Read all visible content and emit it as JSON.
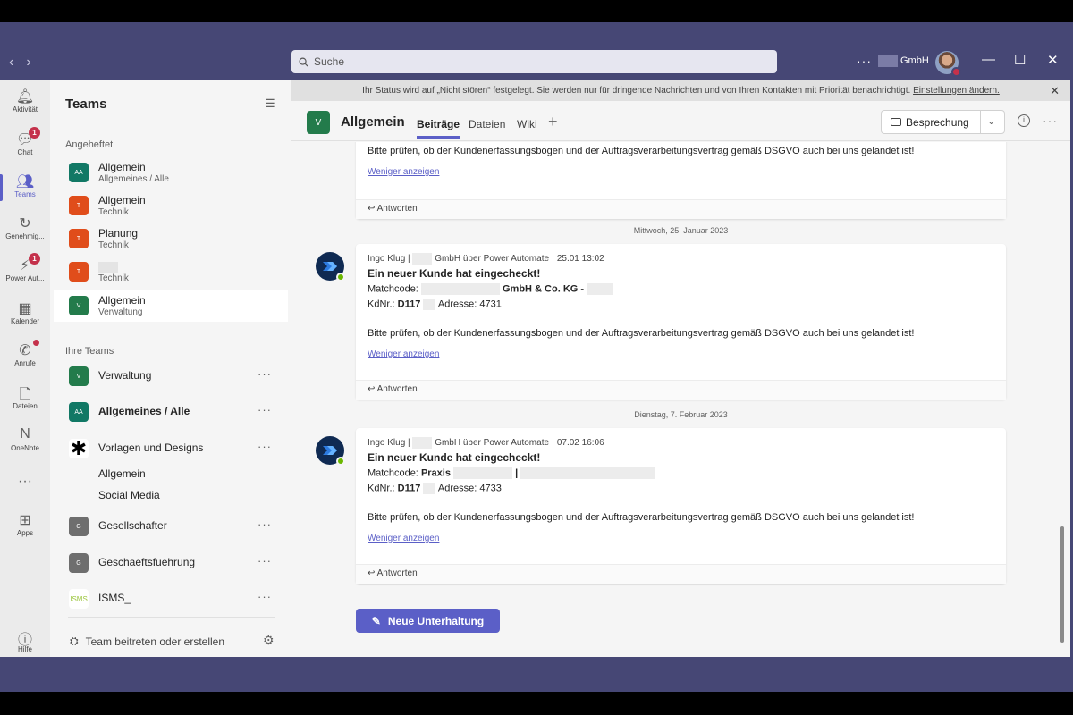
{
  "titlebar": {
    "search_placeholder": "Suche",
    "more": "···",
    "org": "GmbH",
    "nav_back": "‹",
    "nav_forward": "›",
    "minimize": "—",
    "maximize": "☐",
    "close": "✕"
  },
  "rail": {
    "activity": "Aktivität",
    "chat": "Chat",
    "chat_badge": "1",
    "teams": "Teams",
    "approvals": "Genehmig...",
    "power_automate": "Power Aut...",
    "power_automate_badge": "1",
    "calendar": "Kalender",
    "calls": "Anrufe",
    "files": "Dateien",
    "onenote": "OneNote",
    "more": "···",
    "apps": "Apps",
    "help": "Hilfe"
  },
  "sidebar": {
    "title": "Teams",
    "pinned_label": "Angeheftet",
    "pinned": [
      {
        "abbr": "AA",
        "name": "Allgemein",
        "team": "Allgemeines / Alle",
        "color": "#117865"
      },
      {
        "abbr": "T",
        "name": "Allgemein",
        "team": "Technik",
        "color": "#e04d1b"
      },
      {
        "abbr": "T",
        "name": "Planung",
        "team": "Technik",
        "color": "#e04d1b"
      },
      {
        "abbr": "T",
        "name": "",
        "team": "Technik",
        "color": "#e04d1b"
      },
      {
        "abbr": "V",
        "name": "Allgemein",
        "team": "Verwaltung",
        "color": "#237b4b"
      }
    ],
    "your_teams_label": "Ihre Teams",
    "teams": [
      {
        "abbr": "V",
        "name": "Verwaltung",
        "color": "#237b4b"
      },
      {
        "abbr": "AA",
        "name": "Allgemeines / Alle",
        "color": "#117865"
      },
      {
        "abbr": "✱",
        "name": "Vorlagen und Designs",
        "color": "#ffffff"
      },
      {
        "abbr": "G",
        "name": "Gesellschafter",
        "color": "#6e6e6e"
      },
      {
        "abbr": "G",
        "name": "Geschaeftsfuehrung",
        "color": "#6e6e6e"
      },
      {
        "abbr": "ISMS",
        "name": "ISMS_",
        "color": "#ffffff"
      }
    ],
    "sub_channels": [
      "Allgemein",
      "Social Media"
    ],
    "more": "···",
    "join": "Team beitreten oder erstellen"
  },
  "main": {
    "banner_text": "Ihr Status wird auf „Nicht stören“ festgelegt. Sie werden nur für dringende Nachrichten und von Ihren Kontakten mit Priorität benachrichtigt.",
    "banner_link": "Einstellungen ändern.",
    "channel_abbr": "V",
    "channel_name": "Allgemein",
    "tabs": [
      "Beiträge",
      "Dateien",
      "Wiki"
    ],
    "meeting_button": "Besprechung",
    "new_conversation": "Neue Unterhaltung"
  },
  "messages": {
    "top": {
      "para": "Bitte prüfen, ob der Kundenerfassungsbogen und der Auftragsverarbeitungsvertrag gemäß DSGVO auch bei uns gelandet ist!",
      "less": "Weniger anzeigen",
      "reply": "Antworten"
    },
    "date1": "Mittwoch, 25. Januar 2023",
    "m1": {
      "author": "Ingo Klug |",
      "via": "GmbH über Power Automate",
      "time": "25.01 13:02",
      "title": "Ein neuer Kunde hat eingecheckt!",
      "match_label": "Matchcode:",
      "match_value": "GmbH & Co. KG -",
      "kd_label": "KdNr.:",
      "kd_value": "D117",
      "addr_label": "Adresse:",
      "addr_value": "4731",
      "para": "Bitte prüfen, ob der Kundenerfassungsbogen und der Auftragsverarbeitungsvertrag gemäß DSGVO auch bei uns gelandet ist!",
      "less": "Weniger anzeigen",
      "reply": "Antworten"
    },
    "date2": "Dienstag, 7. Februar 2023",
    "m2": {
      "author": "Ingo Klug |",
      "via": "GmbH über Power Automate",
      "time": "07.02 16:06",
      "title": "Ein neuer Kunde hat eingecheckt!",
      "match_label": "Matchcode:",
      "match_value": "Praxis",
      "kd_label": "KdNr.:",
      "kd_value": "D117",
      "addr_label": "Adresse:",
      "addr_value": "4733",
      "para": "Bitte prüfen, ob der Kundenerfassungsbogen und der Auftragsverarbeitungsvertrag gemäß DSGVO auch bei uns gelandet ist!",
      "less": "Weniger anzeigen",
      "reply": "Antworten"
    }
  },
  "colors": {
    "brand": "#464775",
    "accent": "#5b5fc7"
  }
}
